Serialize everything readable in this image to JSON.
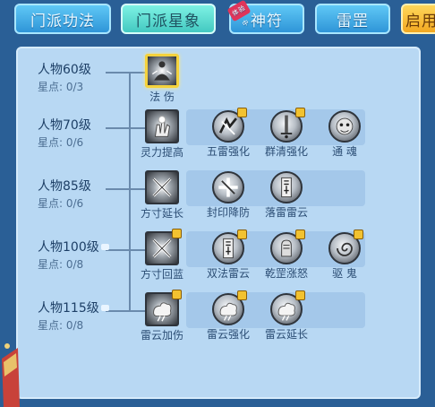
{
  "tabs": [
    {
      "label": "门派功法",
      "state": "normal"
    },
    {
      "label": "门派星象",
      "state": "active"
    },
    {
      "label": "神符",
      "state": "normal",
      "badge": "体验中"
    },
    {
      "label": "雷罡",
      "state": "normal"
    },
    {
      "label": "启用",
      "state": "gold"
    }
  ],
  "rows": [
    {
      "level": "人物60级",
      "stars": "星点: 0/3",
      "locked": false,
      "main": {
        "name": "法 伤",
        "icon": "meditation-figure-icon",
        "selected": true,
        "locked": false
      },
      "subs": []
    },
    {
      "level": "人物70级",
      "stars": "星点: 0/6",
      "locked": false,
      "main": {
        "name": "灵力提高",
        "icon": "glowing-hand-icon",
        "selected": false,
        "locked": false
      },
      "subs": [
        {
          "name": "五雷强化",
          "icon": "thunder-claw-icon",
          "locked": true
        },
        {
          "name": "群清强化",
          "icon": "sword-icon",
          "locked": true
        },
        {
          "name": "通 魂",
          "icon": "ghost-face-icon",
          "locked": false
        }
      ]
    },
    {
      "level": "人物85级",
      "stars": "星点: 0/6",
      "locked": false,
      "main": {
        "name": "方寸延长",
        "icon": "crossed-swords-icon",
        "selected": false,
        "locked": false
      },
      "subs": [
        {
          "name": "封印降防",
          "icon": "seal-cross-icon",
          "locked": false
        },
        {
          "name": "落雷雷云",
          "icon": "talisman-icon",
          "locked": false
        }
      ]
    },
    {
      "level": "人物100级",
      "stars": "星点: 0/8",
      "locked": true,
      "main": {
        "name": "方寸回蓝",
        "icon": "crossed-swords-icon",
        "selected": false,
        "locked": true
      },
      "subs": [
        {
          "name": "双法雷云",
          "icon": "talisman-icon",
          "locked": true
        },
        {
          "name": "乾罡涨怒",
          "icon": "fist-power-icon",
          "locked": true
        },
        {
          "name": "驱 鬼",
          "icon": "spirit-swirl-icon",
          "locked": true
        }
      ]
    },
    {
      "level": "人物115级",
      "stars": "星点: 0/8",
      "locked": true,
      "main": {
        "name": "雷云加伤",
        "icon": "storm-cloud-icon",
        "selected": false,
        "locked": true
      },
      "subs": [
        {
          "name": "雷云强化",
          "icon": "storm-cloud-icon",
          "locked": true
        },
        {
          "name": "雷云延长",
          "icon": "storm-cloud-icon",
          "locked": true
        }
      ]
    }
  ]
}
